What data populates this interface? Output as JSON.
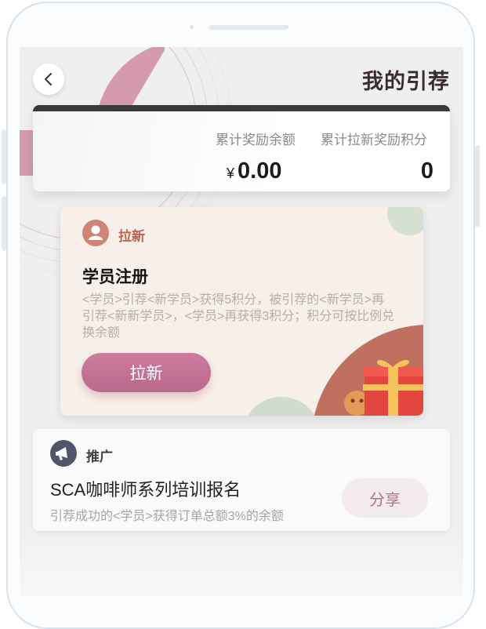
{
  "header": {
    "title": "我的引荐"
  },
  "balance": {
    "reward_balance_label": "累计奖励余额",
    "currency_symbol": "¥",
    "reward_balance_value": "0.00",
    "points_label": "累计拉新奖励积分",
    "points_value": "0"
  },
  "invite": {
    "tag": "拉新",
    "title": "学员注册",
    "description": "<学员>引荐<新学员>获得5积分，被引荐的<新学员>再引荐<新新学员>，<学员>再获得3积分；积分可按比例兑换余额",
    "button": "拉新"
  },
  "promo": {
    "tag": "推广",
    "title": "SCA咖啡师系列培训报名",
    "description": "引荐成功的<学员>获得订单总额3%的余额",
    "button": "分享"
  },
  "colors": {
    "accent": "#c27394",
    "invite_tag": "#c0624f",
    "promo_tag": "#4f5669"
  },
  "icons": {
    "back": "chevron-left-icon",
    "invite": "user-icon",
    "promo": "megaphone-icon",
    "decor": "gift-box-icon"
  }
}
